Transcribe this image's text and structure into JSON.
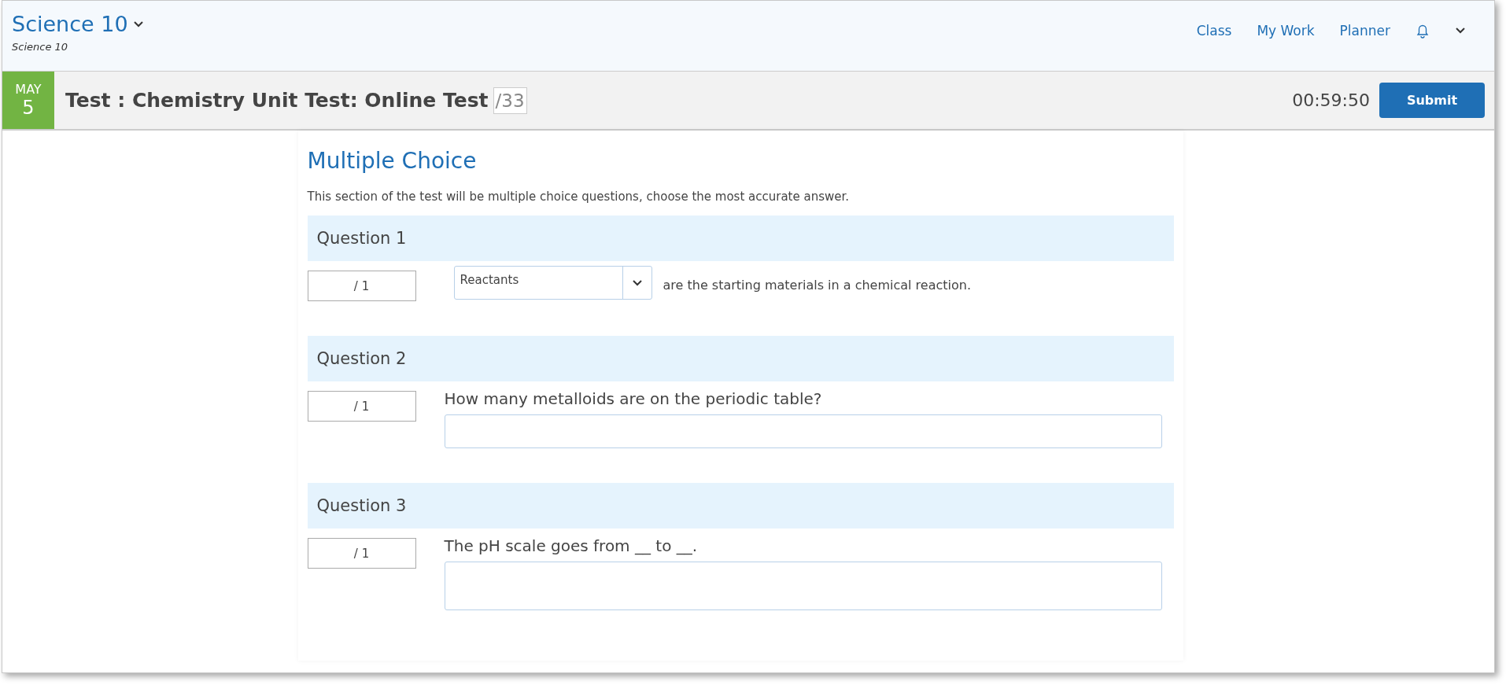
{
  "header": {
    "course_title": "Science 10",
    "course_subtitle": "Science 10",
    "nav": [
      {
        "label": "Class"
      },
      {
        "label": "My Work"
      },
      {
        "label": "Planner"
      }
    ]
  },
  "assignment": {
    "month": "MAY",
    "day": "5",
    "title": "Test : Chemistry Unit Test: Online Test",
    "total": "/33",
    "timer": "00:59:50",
    "submit_label": "Submit"
  },
  "section": {
    "title": "Multiple Choice",
    "description": "This section of the test will be multiple choice questions, choose the most accurate answer.",
    "questions": [
      {
        "heading": "Question 1",
        "score": "/ 1",
        "kind": "dropdown",
        "value": "Reactants",
        "text": "are the starting materials in a chemical reaction."
      },
      {
        "heading": "Question 2",
        "score": "/ 1",
        "kind": "short",
        "text": "How many metalloids are on the periodic table?"
      },
      {
        "heading": "Question 3",
        "score": "/ 1",
        "kind": "long",
        "text": "The pH scale goes from __ to __."
      }
    ]
  }
}
